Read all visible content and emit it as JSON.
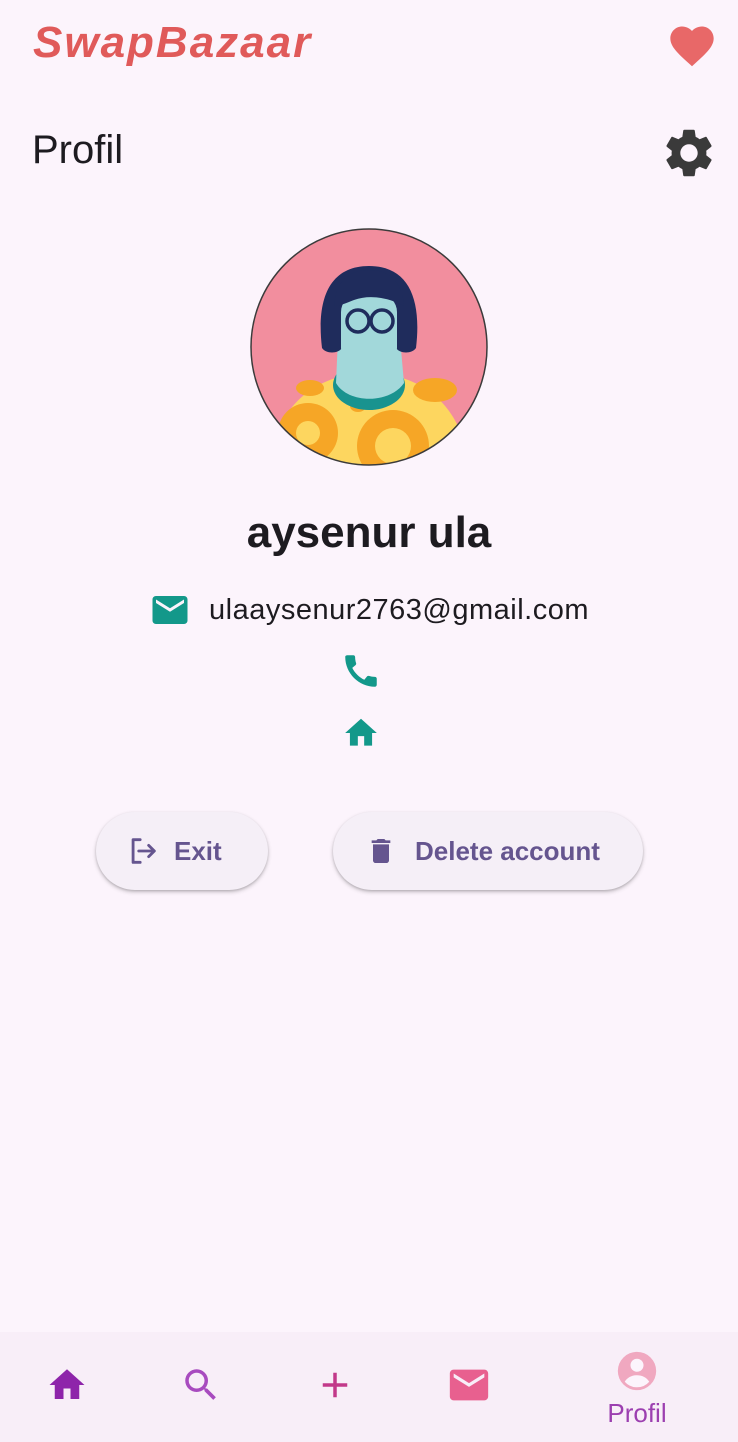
{
  "app": {
    "title": "SwapBazaar"
  },
  "header": {
    "page_title": "Profil"
  },
  "profile": {
    "name": "aysenur ula",
    "email": "ulaaysenur2763@gmail.com",
    "phone": "",
    "address": ""
  },
  "actions": {
    "exit_label": "Exit",
    "delete_label": "Delete account"
  },
  "bottom_nav": {
    "items": [
      {
        "icon": "home-icon",
        "label": ""
      },
      {
        "icon": "search-icon",
        "label": ""
      },
      {
        "icon": "add-icon",
        "label": ""
      },
      {
        "icon": "mail-icon",
        "label": ""
      },
      {
        "icon": "account-icon",
        "label": "Profil",
        "selected": true
      }
    ]
  },
  "colors": {
    "brand": "#e05a5a",
    "accent_teal": "#13988a",
    "nav_purple": "#8e24aa",
    "nav_pink": "#e8608f",
    "button_text": "#65558f",
    "background": "#fcf4fc"
  }
}
